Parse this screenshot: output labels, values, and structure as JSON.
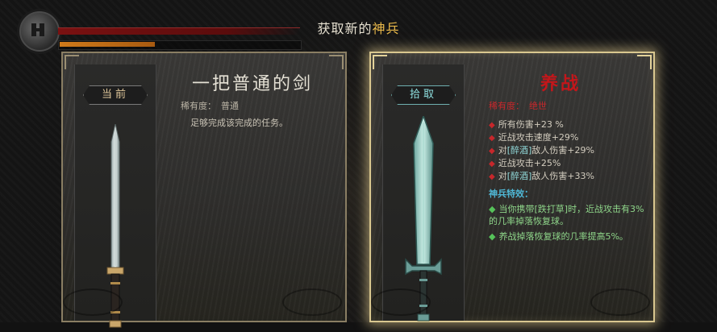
{
  "header": {
    "title_prefix": "获取新的",
    "title_highlight": "神兵"
  },
  "hud": {
    "emblem_icon": "character-emblem-icon",
    "health_fill": 0.55,
    "energy_fill": 0.4
  },
  "current": {
    "tag": "当前",
    "name": "一把普通的剑",
    "rarity_label": "稀有度：",
    "rarity_value": "普通",
    "description": "足够完成该完成的任务。"
  },
  "pickup": {
    "tag": "拾取",
    "name": "养战",
    "rarity_label": "稀有度：",
    "rarity_value": "绝世",
    "stats": [
      {
        "text": "所有伤害+23 %"
      },
      {
        "text": "近战攻击速度+29%"
      },
      {
        "prefix": "对",
        "tag": "[醉酒]",
        "suffix": "敌人伤害+29%"
      },
      {
        "text": "近战攻击+25%"
      },
      {
        "prefix": "对",
        "tag": "[醉酒]",
        "suffix": "敌人伤害+33%"
      }
    ],
    "special_title": "神兵特效：",
    "specials": [
      "当你携带[跌打草]时，近战攻击有3%的几率掉落恢复球。",
      "养战掉落恢复球的几率提高5%。"
    ]
  },
  "colors": {
    "gold_accent": "#e8b84a",
    "rarity_red": "#c7272b",
    "special_green": "#8fd68a",
    "special_title_blue": "#4fb8d6"
  }
}
